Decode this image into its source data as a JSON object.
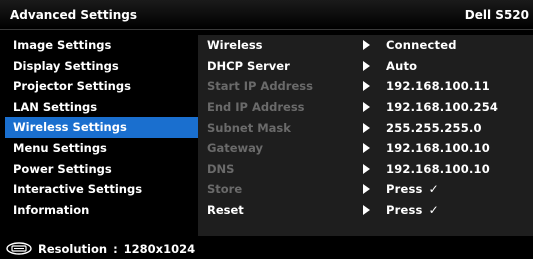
{
  "header": {
    "title": "Advanced Settings",
    "model": "Dell S520"
  },
  "menu": {
    "items": [
      {
        "label": "Image Settings"
      },
      {
        "label": "Display Settings"
      },
      {
        "label": "Projector Settings"
      },
      {
        "label": "LAN Settings"
      },
      {
        "label": "Wireless Settings",
        "selected": true
      },
      {
        "label": "Menu Settings"
      },
      {
        "label": "Power Settings"
      },
      {
        "label": "Interactive Settings"
      },
      {
        "label": "Information"
      }
    ]
  },
  "wireless": {
    "rows": [
      {
        "label": "Wireless",
        "value": "Connected",
        "enabled": true
      },
      {
        "label": "DHCP Server",
        "value": "Auto",
        "enabled": true
      },
      {
        "label": "Start IP Address",
        "value": "192.168.100.11",
        "enabled": false
      },
      {
        "label": "End IP Address",
        "value": "192.168.100.254",
        "enabled": false
      },
      {
        "label": "Subnet Mask",
        "value": "255.255.255.0",
        "enabled": false
      },
      {
        "label": "Gateway",
        "value": "192.168.100.10",
        "enabled": false
      },
      {
        "label": "DNS",
        "value": "192.168.100.10",
        "enabled": false
      },
      {
        "label": "Store",
        "value": "Press",
        "check": "✓",
        "enabled": false
      },
      {
        "label": "Reset",
        "value": "Press",
        "check": "✓",
        "enabled": true
      }
    ]
  },
  "status": {
    "resolution_label": "Resolution",
    "separator": ":",
    "resolution_value": "1280x1024",
    "icon": "input-source-icon"
  },
  "colors": {
    "accent": "#1a6fcf",
    "panel": "#1e1e1e",
    "disabled": "#6a6a6a"
  }
}
